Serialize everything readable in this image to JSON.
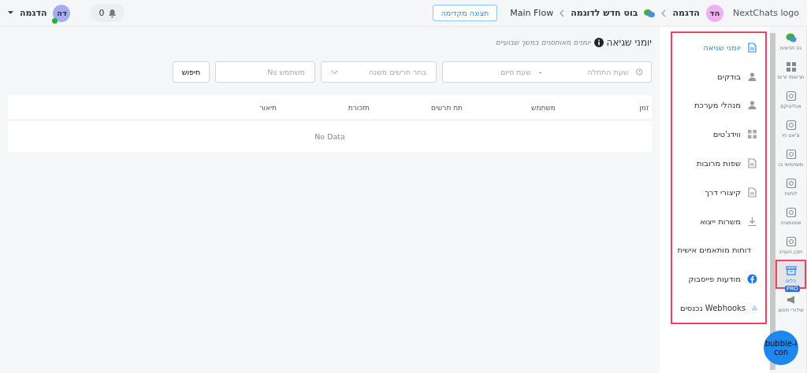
{
  "header": {
    "logo_alt": "NextChats logo",
    "account_initials": "הד",
    "account_name": "הדגמה",
    "breadcrumbs": [
      {
        "label": "בוט חדש לדוגמה"
      },
      {
        "label": "Main Flow"
      }
    ],
    "preview_button": "תצוגה מקדימה",
    "notifications_count": "0",
    "user": {
      "initials": "דה",
      "name": "הדגמה",
      "online": true
    }
  },
  "rail": [
    {
      "label": "נה תרשימ",
      "selected": false
    },
    {
      "label": "תרשימי זרימ",
      "selected": false
    },
    {
      "label": "אנליטיקס",
      "selected": false
    },
    {
      "label": "צ'אט חי",
      "selected": false
    },
    {
      "label": "משתמשי בו",
      "selected": false
    },
    {
      "label": "לוחות",
      "selected": false
    },
    {
      "label": "אוטומציה",
      "selected": false
    },
    {
      "label": "תוכן העניינ",
      "selected": false
    },
    {
      "label": "כלים",
      "selected": true
    },
    {
      "label": "שידורי תפוצ",
      "selected": false,
      "badge": "PRO"
    }
  ],
  "tools_menu": [
    {
      "label": "יומני שגיאה",
      "selected": true
    },
    {
      "label": "בודקים",
      "selected": false
    },
    {
      "label": "מנהלי מערכת",
      "selected": false
    },
    {
      "label": "ווידג'טים",
      "selected": false
    },
    {
      "label": "שפות מרובות",
      "selected": false
    },
    {
      "label": "קיצורי דרך",
      "selected": false
    },
    {
      "label": "משרות ייצוא",
      "selected": false
    },
    {
      "label": "דוחות מותאמים אישית",
      "selected": false
    },
    {
      "label": "מודעות פייסבוק",
      "selected": false
    },
    {
      "label": "Webhooks נכנסים",
      "selected": false
    }
  ],
  "page": {
    "title": "יומני שגיאה",
    "subtitle": "יומנים מאוחסנים במשך שבועיים",
    "filters": {
      "start_placeholder": "שעת התחלה",
      "separator": "-",
      "end_placeholder": "שעת סיום",
      "flow_placeholder": "בחר תרשים משנה",
      "user_placeholder": "משתמש Ns",
      "search_button": "חיפוש"
    },
    "table": {
      "columns": [
        "זמן",
        "משתמש",
        "תת תרשים",
        "תזכורת",
        "תיאור"
      ],
      "empty_text": "No Data"
    }
  },
  "bubble": {
    "alt": "bubble-icon"
  }
}
